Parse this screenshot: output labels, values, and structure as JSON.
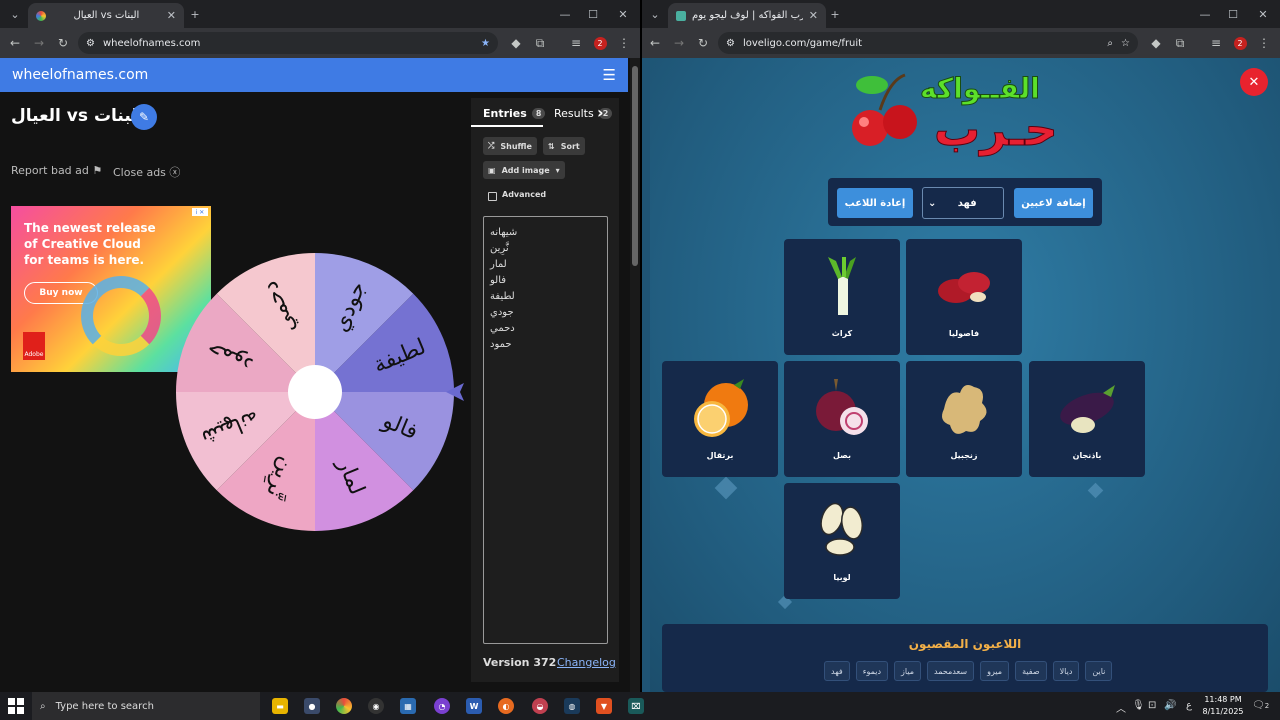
{
  "left_window": {
    "tab_title": "العيال vs البنات",
    "url": "wheelofnames.com",
    "site_name": "wheelofnames.com",
    "wheel_title": "العيال vs البنات",
    "report_ad": "Report bad ad",
    "close_ads": "Close ads",
    "ad": {
      "text": "The newest release of Creative Cloud for teams is here.",
      "button": "Buy now",
      "brand": "Adobe"
    },
    "tabs": {
      "entries": "Entries",
      "entries_count": "8",
      "results": "Results",
      "results_count": "2"
    },
    "buttons": {
      "shuffle": "Shuffle",
      "sort": "Sort",
      "add_image": "Add image"
    },
    "advanced_label": "Advanced",
    "entries": [
      "شيهانه",
      "نَّرِين",
      "لمار",
      "فالو",
      "لطيفة",
      "جودي",
      "دحمي",
      "حمود"
    ],
    "wheel_segments": [
      {
        "label": "جودي",
        "color": "#9f9ee6"
      },
      {
        "label": "لطيفة",
        "color": "#7572d2"
      },
      {
        "label": "فالو",
        "color": "#9a92e0"
      },
      {
        "label": "لمار",
        "color": "#d190e0"
      },
      {
        "label": "نَّرِين",
        "color": "#eea6c4"
      },
      {
        "label": "شيهانه",
        "color": "#f2bfd2"
      },
      {
        "label": "حمود",
        "color": "#eba8c4"
      },
      {
        "label": "دحمي",
        "color": "#f5c8cf"
      }
    ],
    "version": "Version 372",
    "changelog": "Changelog"
  },
  "right_window": {
    "tab_title": "لعبة حرب الفواكه | لوف ليجو يوم...",
    "url": "loveligo.com/game/fruit",
    "logo_line1": "الفــواكه",
    "logo_line2": "حـرب",
    "add_players_button": "إضافة لاعبين",
    "reset_player_button": "إعادة اللاعب",
    "selected_player": "فهد",
    "cards": [
      {
        "label": "فاصوليا",
        "icon": "red-beans-icon"
      },
      {
        "label": "كراث",
        "icon": "leek-icon"
      },
      {
        "label": "باذنجان",
        "icon": "eggplant-icon"
      },
      {
        "label": "زنجبيل",
        "icon": "ginger-icon"
      },
      {
        "label": "بصل",
        "icon": "onion-icon"
      },
      {
        "label": "برتقال",
        "icon": "orange-icon"
      },
      {
        "label": "لوبيا",
        "icon": "white-beans-icon"
      }
    ],
    "eliminated_title": "اللاعبون المقصيون",
    "eliminated_players": [
      "ناين",
      "ديالا",
      "صفية",
      "ميرو",
      "سعدمحمد",
      "مياز",
      "ديموء",
      "فهد"
    ]
  },
  "taskbar": {
    "search_placeholder": "Type here to search",
    "time": "11:48 PM",
    "date": "8/11/2025",
    "language": "ع",
    "notification_count": "2"
  }
}
